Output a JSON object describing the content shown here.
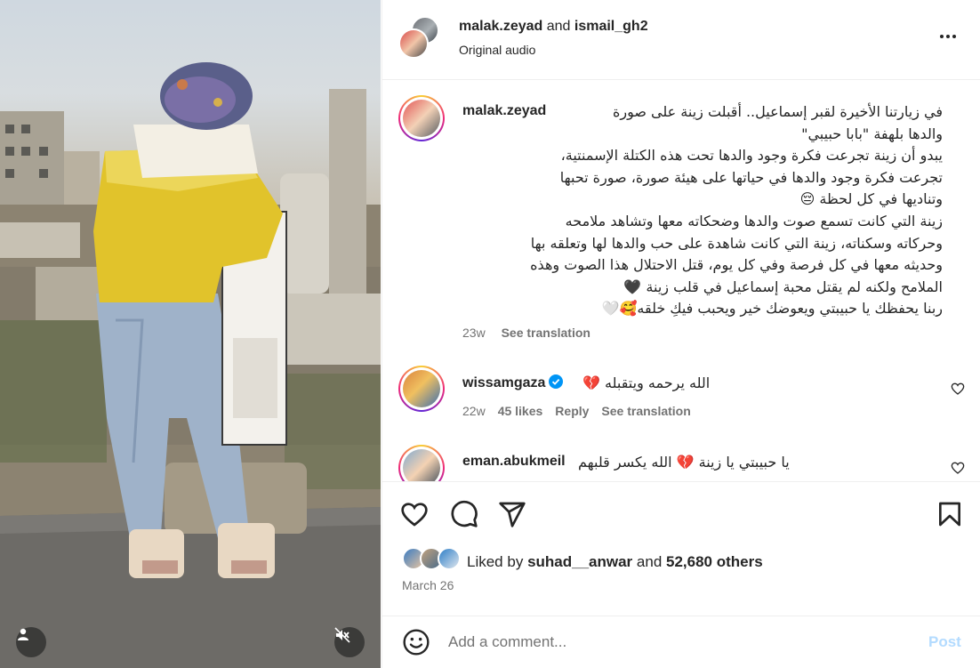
{
  "post": {
    "author_primary": "malak.zeyad",
    "and_text": "and",
    "author_collab": "ismail_gh2",
    "audio_label": "Original audio"
  },
  "caption": {
    "username": "malak.zeyad",
    "text": "في زيارتنا الأخيرة لقبر إسماعيل.. أقبلت زينة على صورة\nوالدها بلهفة \"بابا حبيبي\"\nيبدو أن زينة تجرعت فكرة وجود والدها تحت هذه الكتلة الإسمنتية،\nتجرعت فكرة وجود والدها في حياتها على هيئة صورة، صورة تحبها\nوتناديها في كل لحظة 😔\nزينة التي كانت تسمع صوت والدها وضحكاته معها وتشاهد ملامحه\nوحركاته وسكناته، زينة التي كانت شاهدة على حب والدها لها وتعلقه بها\nوحديثه معها في كل فرصة وفي كل يوم، قتل الاحتلال هذا الصوت وهذه\nالملامح ولكنه لم يقتل محبة إسماعيل في قلب زينة 🖤\nربنا يحفظك يا حبيبتي ويعوضك خير ويحبب فيكِ خلقه🥰🤍",
    "age": "23w",
    "translate_label": "See translation"
  },
  "comments": [
    {
      "username": "wissamgaza",
      "verified": true,
      "text": "الله يرحمه ويتقبله 💔",
      "age": "22w",
      "likes": "45 likes",
      "reply_label": "Reply",
      "translate_label": "See translation"
    },
    {
      "username": "eman.abukmeil",
      "verified": false,
      "text": "يا حبيبتي يا زينة 💔 الله يكسر قلبهم"
    }
  ],
  "engagement": {
    "liked_by_prefix": "Liked by",
    "liked_by_user": "suhad__anwar",
    "and_text": "and",
    "others_count": "52,680 others",
    "date": "March 26"
  },
  "composer": {
    "placeholder": "Add a comment...",
    "post_label": "Post"
  },
  "icons": {
    "more": "more-options-icon",
    "like": "heart-icon",
    "comment": "comment-icon",
    "share": "share-icon",
    "save": "bookmark-icon",
    "emoji": "emoji-icon",
    "user_tag": "person-icon",
    "mute": "speaker-muted-icon",
    "verified": "verified-badge-icon"
  },
  "colors": {
    "text": "#262626",
    "secondary": "#737373",
    "border": "#efefef",
    "post_disabled": "#b3dbff",
    "verified": "#0095f6"
  }
}
